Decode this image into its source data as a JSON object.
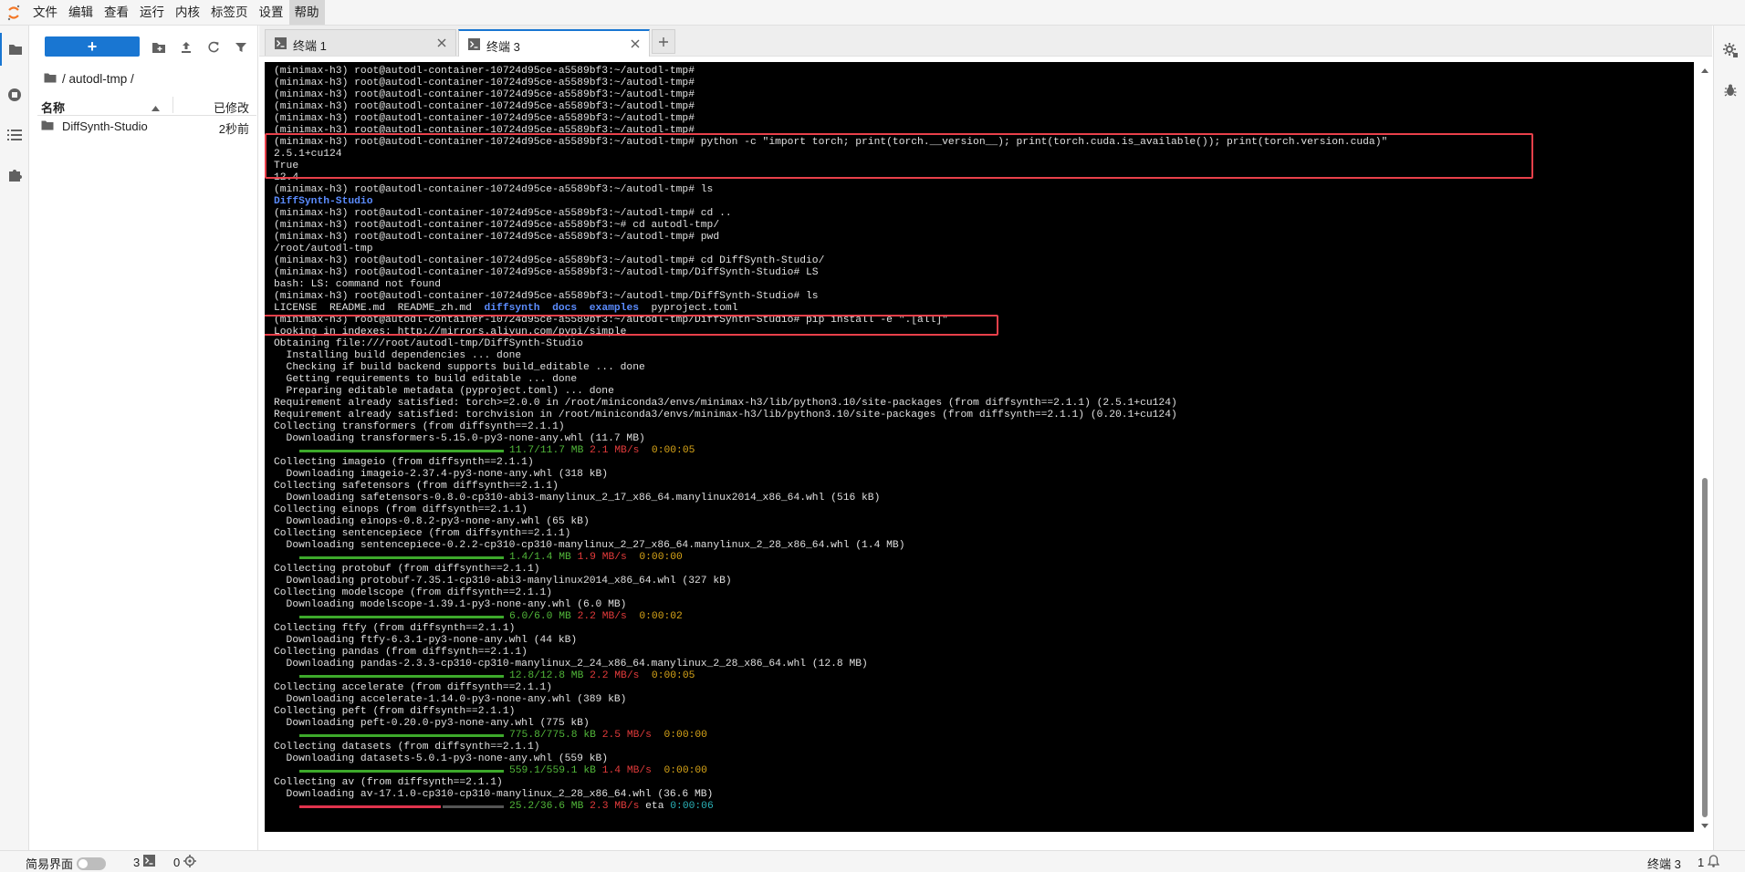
{
  "menubar": {
    "items": [
      "文件",
      "编辑",
      "查看",
      "运行",
      "内核",
      "标签页",
      "设置",
      "帮助"
    ],
    "active_index": 7
  },
  "activity_icons": [
    "folder-icon",
    "running-sessions-icon",
    "table-of-contents-icon",
    "extension-puzzle-icon"
  ],
  "filebrowser": {
    "new_label": "+",
    "path": "/ autodl-tmp /",
    "column_name": "名称",
    "column_modified": "已修改",
    "items": [
      {
        "name": "DiffSynth-Studio",
        "modified": "2秒前"
      }
    ]
  },
  "tabs": [
    {
      "label": "终端 1",
      "active": false
    },
    {
      "label": "终端 3",
      "active": true
    }
  ],
  "terminal": {
    "lines": [
      "(minimax-h3) root@autodl-container-10724d95ce-a5589bf3:~/autodl-tmp#",
      "(minimax-h3) root@autodl-container-10724d95ce-a5589bf3:~/autodl-tmp#",
      "(minimax-h3) root@autodl-container-10724d95ce-a5589bf3:~/autodl-tmp#",
      "(minimax-h3) root@autodl-container-10724d95ce-a5589bf3:~/autodl-tmp#",
      "(minimax-h3) root@autodl-container-10724d95ce-a5589bf3:~/autodl-tmp#",
      "(minimax-h3) root@autodl-container-10724d95ce-a5589bf3:~/autodl-tmp#",
      "(minimax-h3) root@autodl-container-10724d95ce-a5589bf3:~/autodl-tmp# python -c \"import torch; print(torch.__version__); print(torch.cuda.is_available()); print(torch.version.cuda)\"",
      "2.5.1+cu124",
      "True",
      "12.4",
      "(minimax-h3) root@autodl-container-10724d95ce-a5589bf3:~/autodl-tmp# ls",
      "§DiffSynth-Studio",
      "(minimax-h3) root@autodl-container-10724d95ce-a5589bf3:~/autodl-tmp# cd ..",
      "(minimax-h3) root@autodl-container-10724d95ce-a5589bf3:~# cd autodl-tmp/",
      "(minimax-h3) root@autodl-container-10724d95ce-a5589bf3:~/autodl-tmp# pwd",
      "/root/autodl-tmp",
      "(minimax-h3) root@autodl-container-10724d95ce-a5589bf3:~/autodl-tmp# cd DiffSynth-Studio/",
      "(minimax-h3) root@autodl-container-10724d95ce-a5589bf3:~/autodl-tmp/DiffSynth-Studio# LS",
      "bash: LS: command not found",
      "(minimax-h3) root@autodl-container-10724d95ce-a5589bf3:~/autodl-tmp/DiffSynth-Studio# ls",
      "LICENSE  README.md  README_zh.md  §diffsynth  §docs  §examples  pyproject.toml",
      "(minimax-h3) root@autodl-container-10724d95ce-a5589bf3:~/autodl-tmp/DiffSynth-Studio# pip install -e \".[all]\"",
      "Looking in indexes: http://mirrors.aliyun.com/pypi/simple",
      "Obtaining file:///root/autodl-tmp/DiffSynth-Studio",
      "  Installing build dependencies ... done",
      "  Checking if build backend supports build_editable ... done",
      "  Getting requirements to build editable ... done",
      "  Preparing editable metadata (pyproject.toml) ... done",
      "Requirement already satisfied: torch>=2.0.0 in /root/miniconda3/envs/minimax-h3/lib/python3.10/site-packages (from diffsynth==2.1.1) (2.5.1+cu124)",
      "Requirement already satisfied: torchvision in /root/miniconda3/envs/minimax-h3/lib/python3.10/site-packages (from diffsynth==2.1.1) (0.20.1+cu124)",
      "Collecting transformers (from diffsynth==2.1.1)",
      "  Downloading transformers-5.15.0-py3-none-any.whl (11.7 MB)",
      {
        "bar": 1.0,
        "size": "11.7/11.7 MB",
        "speed": "2.1 MB/s",
        "time": "0:00:05"
      },
      "Collecting imageio (from diffsynth==2.1.1)",
      "  Downloading imageio-2.37.4-py3-none-any.whl (318 kB)",
      "Collecting safetensors (from diffsynth==2.1.1)",
      "  Downloading safetensors-0.8.0-cp310-abi3-manylinux_2_17_x86_64.manylinux2014_x86_64.whl (516 kB)",
      "Collecting einops (from diffsynth==2.1.1)",
      "  Downloading einops-0.8.2-py3-none-any.whl (65 kB)",
      "Collecting sentencepiece (from diffsynth==2.1.1)",
      "  Downloading sentencepiece-0.2.2-cp310-cp310-manylinux_2_27_x86_64.manylinux_2_28_x86_64.whl (1.4 MB)",
      {
        "bar": 1.0,
        "size": "1.4/1.4 MB",
        "speed": "1.9 MB/s",
        "time": "0:00:00"
      },
      "Collecting protobuf (from diffsynth==2.1.1)",
      "  Downloading protobuf-7.35.1-cp310-abi3-manylinux2014_x86_64.whl (327 kB)",
      "Collecting modelscope (from diffsynth==2.1.1)",
      "  Downloading modelscope-1.39.1-py3-none-any.whl (6.0 MB)",
      {
        "bar": 1.0,
        "size": "6.0/6.0 MB",
        "speed": "2.2 MB/s",
        "time": "0:00:02"
      },
      "Collecting ftfy (from diffsynth==2.1.1)",
      "  Downloading ftfy-6.3.1-py3-none-any.whl (44 kB)",
      "Collecting pandas (from diffsynth==2.1.1)",
      "  Downloading pandas-2.3.3-cp310-cp310-manylinux_2_24_x86_64.manylinux_2_28_x86_64.whl (12.8 MB)",
      {
        "bar": 1.0,
        "size": "12.8/12.8 MB",
        "speed": "2.2 MB/s",
        "time": "0:00:05"
      },
      "Collecting accelerate (from diffsynth==2.1.1)",
      "  Downloading accelerate-1.14.0-py3-none-any.whl (389 kB)",
      "Collecting peft (from diffsynth==2.1.1)",
      "  Downloading peft-0.20.0-py3-none-any.whl (775 kB)",
      {
        "bar": 1.0,
        "size": "775.8/775.8 kB",
        "speed": "2.5 MB/s",
        "time": "0:00:00"
      },
      "Collecting datasets (from diffsynth==2.1.1)",
      "  Downloading datasets-5.0.1-py3-none-any.whl (559 kB)",
      {
        "bar": 1.0,
        "size": "559.1/559.1 kB",
        "speed": "1.4 MB/s",
        "time": "0:00:00"
      },
      "Collecting av (from diffsynth==2.1.1)",
      "  Downloading av-17.1.0-cp310-cp310-manylinux_2_28_x86_64.whl (36.6 MB)",
      {
        "bar": 0.69,
        "size": "25.2/36.6 MB",
        "speed": "2.3 MB/s",
        "eta_label": "eta",
        "time": "0:00:06"
      }
    ]
  },
  "colors": {
    "accent": "#1976d2",
    "highlight_box": "#e8404a",
    "terminal_bg": "#000000",
    "dir": "#5b8cff",
    "progress_done": "#3da92b",
    "progress_partial": "#e0334d"
  },
  "right_icons": [
    "property-inspector-gear-icon",
    "debugger-bug-icon"
  ],
  "statusbar": {
    "simple_mode": "简易界面",
    "terminal_count": "3",
    "kernel_count": "0",
    "right_label": "终端 3",
    "right_count": "1"
  }
}
